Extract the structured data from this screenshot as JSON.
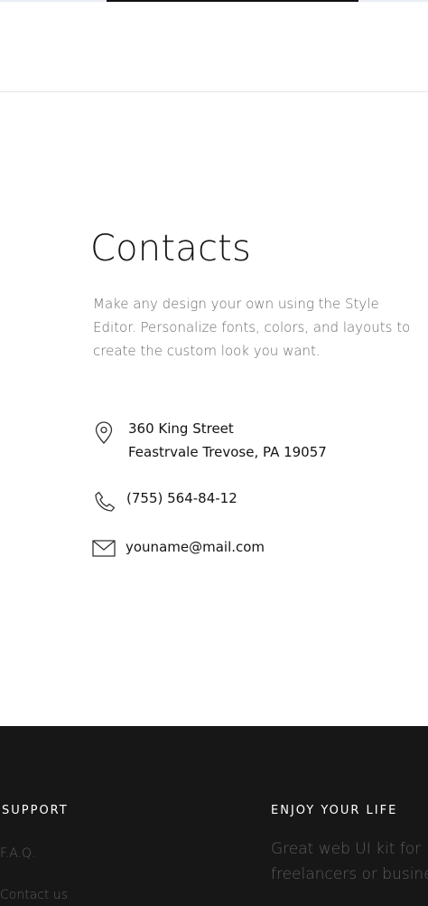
{
  "contacts": {
    "title": "Contacts",
    "description": "Make any design your own using the Style Editor. Personalize fonts, colors, and layouts to create the custom look you want.",
    "address_line1": "360 King Street",
    "address_line2": "Feastrvale Trevose, PA 19057",
    "phone": "(755) 564-84-12",
    "email": "youname@mail.com",
    "icons": {
      "address": "location-pin-icon",
      "phone": "phone-icon",
      "email": "mail-icon"
    }
  },
  "footer": {
    "support_heading": "SUPPORT",
    "links": [
      "F.A.Q.",
      "Contact us"
    ],
    "enjoy_heading": "ENJOY YOUR LIFE",
    "tagline_line1": "Great web UI kit for",
    "tagline_line2": "freelancers or busine"
  },
  "colors": {
    "background": "#ffffff",
    "footer_background": "#171717",
    "text": "#141414",
    "muted_text": "#6a6a6a",
    "footer_heading": "#ffffff",
    "footer_link": "#5c5c5c"
  }
}
